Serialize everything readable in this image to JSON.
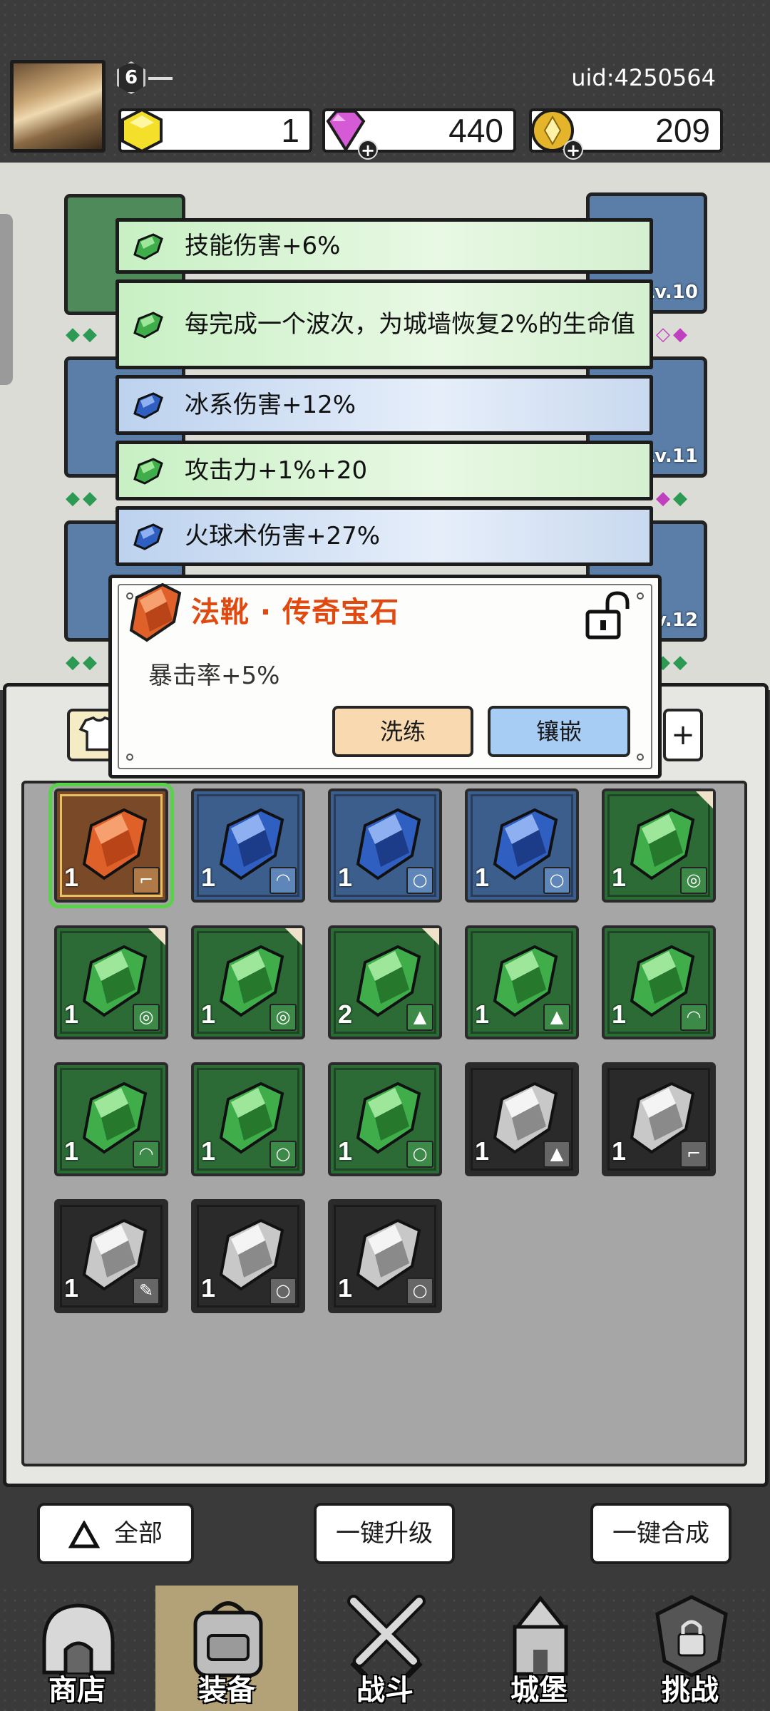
{
  "header": {
    "level": "6",
    "uid": "uid:4250564",
    "resources": [
      {
        "name": "gold-crystal",
        "value": "1"
      },
      {
        "name": "diamond",
        "value": "440"
      },
      {
        "name": "coin",
        "value": "209"
      }
    ]
  },
  "equip_slots": [
    {
      "level": ""
    },
    {
      "level": "Lv.10"
    },
    {
      "level": ""
    },
    {
      "level": "Lv.11"
    },
    {
      "level": ""
    },
    {
      "level": "Lv.12"
    }
  ],
  "skill_list": [
    {
      "color": "green",
      "text": "技能伤害+6%"
    },
    {
      "color": "green",
      "text": "每完成一个波次，为城墙恢复2%的生命值"
    },
    {
      "color": "blue",
      "text": "冰系伤害+12%"
    },
    {
      "color": "green",
      "text": "攻击力+1%+20"
    },
    {
      "color": "blue",
      "text": "火球术伤害+27%"
    }
  ],
  "popup": {
    "title": "法靴 · 传奇宝石",
    "stat": "暴击率+5%",
    "reforge_label": "洗练",
    "inlay_label": "镶嵌"
  },
  "filter_tab_right": "+",
  "gems": [
    {
      "color": "orange",
      "count": "1",
      "slot_icon": "boot",
      "selected": true
    },
    {
      "color": "blue",
      "count": "1",
      "slot_icon": "helmet"
    },
    {
      "color": "blue",
      "count": "1",
      "slot_icon": "ring"
    },
    {
      "color": "blue",
      "count": "1",
      "slot_icon": "ring"
    },
    {
      "color": "green",
      "count": "1",
      "slot_icon": "bracer",
      "corner": true
    },
    {
      "color": "green",
      "count": "1",
      "slot_icon": "bracer",
      "corner": true
    },
    {
      "color": "green",
      "count": "1",
      "slot_icon": "bracer",
      "corner": true
    },
    {
      "color": "green",
      "count": "2",
      "slot_icon": "armor",
      "corner": true
    },
    {
      "color": "green",
      "count": "1",
      "slot_icon": "armor"
    },
    {
      "color": "green",
      "count": "1",
      "slot_icon": "helmet"
    },
    {
      "color": "green",
      "count": "1",
      "slot_icon": "helmet"
    },
    {
      "color": "green",
      "count": "1",
      "slot_icon": "ring"
    },
    {
      "color": "green",
      "count": "1",
      "slot_icon": "ring"
    },
    {
      "color": "gray",
      "count": "1",
      "slot_icon": "armor"
    },
    {
      "color": "gray",
      "count": "1",
      "slot_icon": "boot"
    },
    {
      "color": "gray",
      "count": "1",
      "slot_icon": "weapon"
    },
    {
      "color": "gray",
      "count": "1",
      "slot_icon": "ring"
    },
    {
      "color": "gray",
      "count": "1",
      "slot_icon": "ring"
    }
  ],
  "actions": {
    "filter_all": "全部",
    "upgrade_all": "一键升级",
    "merge_all": "一键合成"
  },
  "nav": [
    {
      "label": "商店",
      "icon": "shop-icon"
    },
    {
      "label": "装备",
      "icon": "backpack-icon",
      "active": true
    },
    {
      "label": "战斗",
      "icon": "swords-icon"
    },
    {
      "label": "城堡",
      "icon": "castle-icon"
    },
    {
      "label": "挑战",
      "icon": "challenge-icon"
    }
  ],
  "colors": {
    "gem_orange": "#e0602a",
    "gem_blue": "#2f5fc0",
    "gem_green": "#3fae4a",
    "gem_gray": "#c8c8c8",
    "title_red": "#e04a10"
  }
}
